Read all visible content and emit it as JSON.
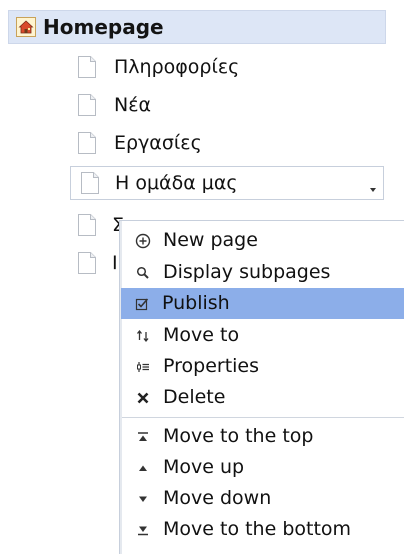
{
  "tree": {
    "root": {
      "label": "Homepage",
      "icon": "home-icon"
    },
    "items": [
      {
        "label": "Πληροφορίες",
        "icon": "page-icon"
      },
      {
        "label": "Νέα",
        "icon": "page-icon"
      },
      {
        "label": "Εργασίες",
        "icon": "page-icon"
      },
      {
        "label": "Η ομάδα μας",
        "icon": "page-icon",
        "selected": true,
        "dropdown_icon": "dropdown-arrow-icon"
      },
      {
        "label": "Σ",
        "icon": "page-icon",
        "partially_hidden": true
      },
      {
        "label": "Ι",
        "icon": "page-icon",
        "partially_hidden": true
      }
    ]
  },
  "context_menu": {
    "items": [
      {
        "label": "New page",
        "icon": "new-page-icon"
      },
      {
        "label": "Display subpages",
        "icon": "display-subpages-icon"
      },
      {
        "label": "Publish",
        "icon": "publish-icon",
        "highlighted": true
      },
      {
        "label": "Move to",
        "icon": "move-to-icon"
      },
      {
        "label": "Properties",
        "icon": "properties-icon"
      },
      {
        "label": "Delete",
        "icon": "delete-icon"
      },
      {
        "label": "Move to the top",
        "icon": "move-top-icon"
      },
      {
        "label": "Move up",
        "icon": "move-up-icon"
      },
      {
        "label": "Move down",
        "icon": "move-down-icon"
      },
      {
        "label": "Move to the bottom",
        "icon": "move-bottom-icon"
      }
    ]
  },
  "colors": {
    "root_background": "#dde6f6",
    "menu_highlight": "#8caee9",
    "border": "#c7cfdc"
  }
}
